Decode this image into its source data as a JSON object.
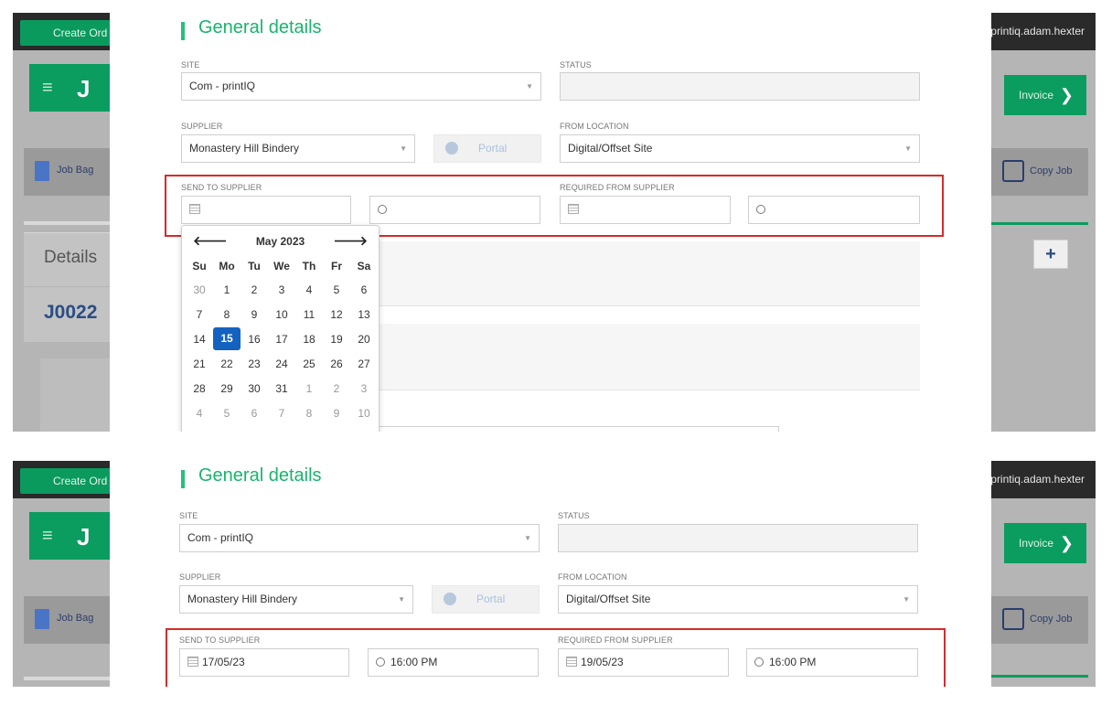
{
  "user": "printiq.adam.hexter",
  "create_order_label": "Create Ord",
  "header_job_fragment": "J",
  "job_bag_label": "Job Bag",
  "details_label": "Details",
  "job_number_fragment": "J0022",
  "invoice_label": "Invoice",
  "copy_job_label": "Copy Job",
  "plus_label": "+",
  "section_title": "General details",
  "labels": {
    "site": "SITE",
    "status": "STATUS",
    "supplier": "SUPPLIER",
    "from_location": "FROM LOCATION",
    "send_to_supplier": "SEND TO SUPPLIER",
    "required_from_supplier": "REQUIRED FROM SUPPLIER"
  },
  "values": {
    "site": "Com - printIQ",
    "status": "",
    "supplier": "Monastery Hill Bindery",
    "portal": "Portal",
    "from_location": "Digital/Offset Site"
  },
  "before": {
    "send_date": "",
    "send_time": "",
    "req_date": "",
    "req_time": ""
  },
  "after": {
    "send_date": "17/05/23",
    "send_time": "16:00 PM",
    "req_date": "19/05/23",
    "req_time": "16:00 PM"
  },
  "calendar": {
    "month": "May 2023",
    "prev": "🡐",
    "next": "🡒",
    "weekdays": [
      "Su",
      "Mo",
      "Tu",
      "We",
      "Th",
      "Fr",
      "Sa"
    ],
    "weeks": [
      [
        "30",
        "1",
        "2",
        "3",
        "4",
        "5",
        "6"
      ],
      [
        "7",
        "8",
        "9",
        "10",
        "11",
        "12",
        "13"
      ],
      [
        "14",
        "15",
        "16",
        "17",
        "18",
        "19",
        "20"
      ],
      [
        "21",
        "22",
        "23",
        "24",
        "25",
        "26",
        "27"
      ],
      [
        "28",
        "29",
        "30",
        "31",
        "1",
        "2",
        "3"
      ],
      [
        "4",
        "5",
        "6",
        "7",
        "8",
        "9",
        "10"
      ]
    ],
    "selected": "15"
  },
  "colors": {
    "accent": "#19b46c",
    "highlight_box": "#d52b2b",
    "selected_day": "#1462c0"
  }
}
